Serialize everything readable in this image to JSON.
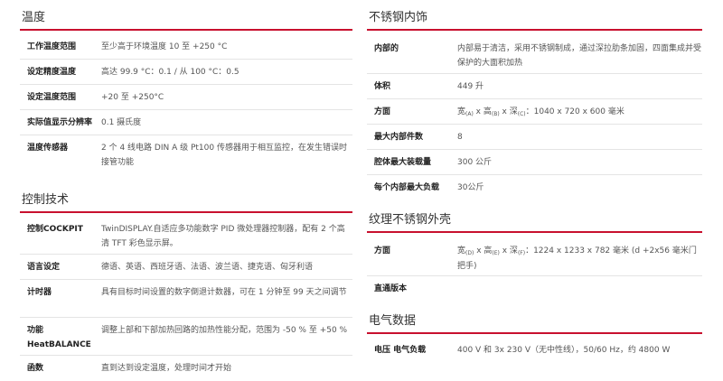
{
  "left": {
    "temp": {
      "title": "温度",
      "rows": [
        {
          "label": "工作温度范围",
          "value": "至少高于环境温度 10 至 +250 °C"
        },
        {
          "label": "设定精度温度",
          "value": "高达 99.9 °C：0.1 / 从 100 °C：0.5"
        },
        {
          "label": "设定温度范围",
          "value": "+20 至 +250°C"
        },
        {
          "label": "实际值显示分辨率",
          "value": "0.1 摄氏度"
        },
        {
          "label": "温度传感器",
          "value": "2 个 4 线电路 DIN A 级 Pt100 传感器用于相互监控，在发生错误时接管功能"
        }
      ]
    },
    "control": {
      "title": "控制技术",
      "rows": [
        {
          "label": "控制COCKPIT",
          "value": "TwinDISPLAY.自适应多功能数字 PID 微处理器控制器，配有 2 个高清 TFT 彩色显示屏。"
        },
        {
          "label": "语言设定",
          "value": "德语、英语、西班牙语、法语、波兰语、捷克语、匈牙利语"
        },
        {
          "label": "计时器",
          "value": "具有目标时间设置的数字倒退计数器，可在 1 分钟至 99 天之间调节"
        },
        {
          "label": "功能 HeatBALANCE",
          "value": "调整上部和下部加热回路的加热性能分配，范围为 -50 % 至 +50 %"
        },
        {
          "label": "函数",
          "value": "直到达到设定温度，处理时间才开始"
        }
      ]
    }
  },
  "right": {
    "interior": {
      "title": "不锈钢内饰",
      "rows": [
        {
          "label": "内部的",
          "value": "内部易于清洁，采用不锈钢制成，通过深拉肋条加固，四面集成并受保护的大面积加热"
        },
        {
          "label": "体积",
          "value": "449 升"
        },
        {
          "label": "方面",
          "parts": [
            "宽",
            "(A)",
            " x 高",
            "(B)",
            " x 深",
            "(C)",
            "：1040 x 720 x 600 毫米"
          ]
        },
        {
          "label": "最大内部件数",
          "value": "8"
        },
        {
          "label": "腔体最大装载量",
          "value": "300 公斤"
        },
        {
          "label": "每个内部最大负载",
          "value": "30公斤"
        }
      ]
    },
    "exterior": {
      "title": "纹理不锈钢外壳",
      "rows": [
        {
          "label": "方面",
          "parts": [
            "宽",
            "(D)",
            " x 高",
            "(E)",
            " x 深",
            "(F)",
            "：1224 x 1233 x 782 毫米 (d +2x56 毫米门把手)"
          ]
        },
        {
          "label": "直通版本",
          "value": ""
        }
      ]
    },
    "electrical": {
      "title": "电气数据",
      "rows": [
        {
          "label": "电压 电气负载",
          "value": "400 V 和 3x 230 V（无中性线），50/60 Hz，约 4800 W"
        }
      ]
    }
  }
}
